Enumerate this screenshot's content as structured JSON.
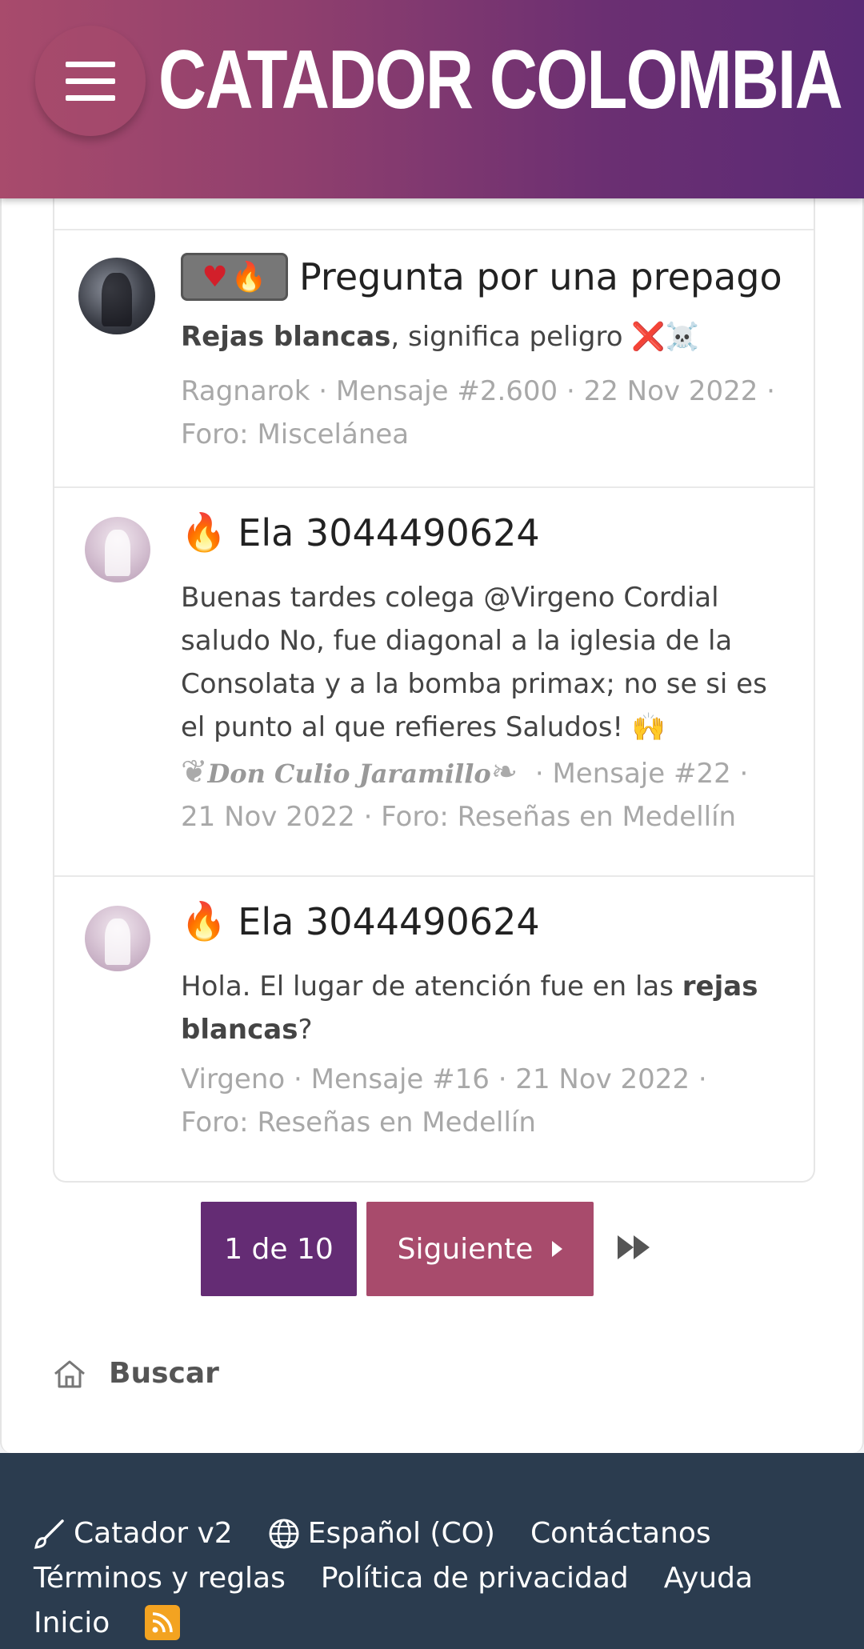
{
  "header": {
    "site_title": "CATADOR COLOMBIA",
    "menu_icon": "hamburger-menu-icon"
  },
  "results": [
    {
      "title": "Pregunta por una prepago",
      "badge_icons": [
        "heart",
        "fire"
      ],
      "snippet_bold": "Rejas blancas",
      "snippet_rest": ", significa peligro",
      "snippet_emoji": "❌☠️",
      "meta_line1": "Ragnarok · Mensaje #2.600 · 22 Nov 2022 ·",
      "meta_line2": "Foro: Miscelánea"
    },
    {
      "title_emoji": "🔥",
      "title": "Ela 3044490624",
      "snippet": "Buenas tardes colega @Virgeno Cordial saludo No, fue diagonal a la iglesia de la Consolata y a la bomba primax; no se si es el punto al que refieres Saludos!",
      "snippet_emoji": "🙌",
      "author": "Don Culio Jaramillo",
      "meta_line1": "· Mensaje #22 ·",
      "meta_line2": "21 Nov 2022 · Foro: Reseñas en Medellín"
    },
    {
      "title_emoji": "🔥",
      "title": "Ela 3044490624",
      "snippet_pre": "Hola. El lugar de atención fue en las ",
      "snippet_bold": "rejas blancas",
      "snippet_post": "?",
      "meta_line1": "Virgeno · Mensaje #16 · 21 Nov 2022 ·",
      "meta_line2": "Foro: Reseñas en Medellín"
    }
  ],
  "pagination": {
    "current": "1 de 10",
    "next_label": "Siguiente"
  },
  "breadcrumb": {
    "label": "Buscar"
  },
  "footer": {
    "style_label": "Catador v2",
    "language_label": "Español (CO)",
    "contact_label": "Contáctanos",
    "terms_label": "Términos y reglas",
    "privacy_label": "Política de privacidad",
    "help_label": "Ayuda",
    "home_label": "Inicio"
  },
  "colors": {
    "header_start": "#a84b6c",
    "header_end": "#5a2a75",
    "pager_current": "#642c74",
    "pager_next": "#a84b6c",
    "footer_bg": "#2b3c4f",
    "rss": "#f3a321"
  }
}
